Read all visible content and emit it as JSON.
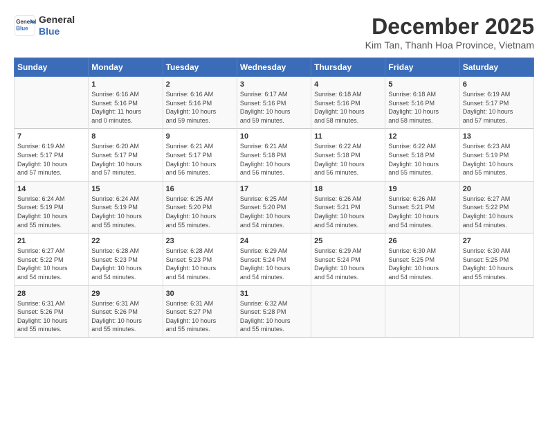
{
  "logo": {
    "line1": "General",
    "line2": "Blue"
  },
  "title": "December 2025",
  "subtitle": "Kim Tan, Thanh Hoa Province, Vietnam",
  "days_of_week": [
    "Sunday",
    "Monday",
    "Tuesday",
    "Wednesday",
    "Thursday",
    "Friday",
    "Saturday"
  ],
  "weeks": [
    [
      {
        "day": "",
        "info": ""
      },
      {
        "day": "1",
        "info": "Sunrise: 6:16 AM\nSunset: 5:16 PM\nDaylight: 11 hours\nand 0 minutes."
      },
      {
        "day": "2",
        "info": "Sunrise: 6:16 AM\nSunset: 5:16 PM\nDaylight: 10 hours\nand 59 minutes."
      },
      {
        "day": "3",
        "info": "Sunrise: 6:17 AM\nSunset: 5:16 PM\nDaylight: 10 hours\nand 59 minutes."
      },
      {
        "day": "4",
        "info": "Sunrise: 6:18 AM\nSunset: 5:16 PM\nDaylight: 10 hours\nand 58 minutes."
      },
      {
        "day": "5",
        "info": "Sunrise: 6:18 AM\nSunset: 5:16 PM\nDaylight: 10 hours\nand 58 minutes."
      },
      {
        "day": "6",
        "info": "Sunrise: 6:19 AM\nSunset: 5:17 PM\nDaylight: 10 hours\nand 57 minutes."
      }
    ],
    [
      {
        "day": "7",
        "info": "Sunrise: 6:19 AM\nSunset: 5:17 PM\nDaylight: 10 hours\nand 57 minutes."
      },
      {
        "day": "8",
        "info": "Sunrise: 6:20 AM\nSunset: 5:17 PM\nDaylight: 10 hours\nand 57 minutes."
      },
      {
        "day": "9",
        "info": "Sunrise: 6:21 AM\nSunset: 5:17 PM\nDaylight: 10 hours\nand 56 minutes."
      },
      {
        "day": "10",
        "info": "Sunrise: 6:21 AM\nSunset: 5:18 PM\nDaylight: 10 hours\nand 56 minutes."
      },
      {
        "day": "11",
        "info": "Sunrise: 6:22 AM\nSunset: 5:18 PM\nDaylight: 10 hours\nand 56 minutes."
      },
      {
        "day": "12",
        "info": "Sunrise: 6:22 AM\nSunset: 5:18 PM\nDaylight: 10 hours\nand 55 minutes."
      },
      {
        "day": "13",
        "info": "Sunrise: 6:23 AM\nSunset: 5:19 PM\nDaylight: 10 hours\nand 55 minutes."
      }
    ],
    [
      {
        "day": "14",
        "info": "Sunrise: 6:24 AM\nSunset: 5:19 PM\nDaylight: 10 hours\nand 55 minutes."
      },
      {
        "day": "15",
        "info": "Sunrise: 6:24 AM\nSunset: 5:19 PM\nDaylight: 10 hours\nand 55 minutes."
      },
      {
        "day": "16",
        "info": "Sunrise: 6:25 AM\nSunset: 5:20 PM\nDaylight: 10 hours\nand 55 minutes."
      },
      {
        "day": "17",
        "info": "Sunrise: 6:25 AM\nSunset: 5:20 PM\nDaylight: 10 hours\nand 54 minutes."
      },
      {
        "day": "18",
        "info": "Sunrise: 6:26 AM\nSunset: 5:21 PM\nDaylight: 10 hours\nand 54 minutes."
      },
      {
        "day": "19",
        "info": "Sunrise: 6:26 AM\nSunset: 5:21 PM\nDaylight: 10 hours\nand 54 minutes."
      },
      {
        "day": "20",
        "info": "Sunrise: 6:27 AM\nSunset: 5:22 PM\nDaylight: 10 hours\nand 54 minutes."
      }
    ],
    [
      {
        "day": "21",
        "info": "Sunrise: 6:27 AM\nSunset: 5:22 PM\nDaylight: 10 hours\nand 54 minutes."
      },
      {
        "day": "22",
        "info": "Sunrise: 6:28 AM\nSunset: 5:23 PM\nDaylight: 10 hours\nand 54 minutes."
      },
      {
        "day": "23",
        "info": "Sunrise: 6:28 AM\nSunset: 5:23 PM\nDaylight: 10 hours\nand 54 minutes."
      },
      {
        "day": "24",
        "info": "Sunrise: 6:29 AM\nSunset: 5:24 PM\nDaylight: 10 hours\nand 54 minutes."
      },
      {
        "day": "25",
        "info": "Sunrise: 6:29 AM\nSunset: 5:24 PM\nDaylight: 10 hours\nand 54 minutes."
      },
      {
        "day": "26",
        "info": "Sunrise: 6:30 AM\nSunset: 5:25 PM\nDaylight: 10 hours\nand 54 minutes."
      },
      {
        "day": "27",
        "info": "Sunrise: 6:30 AM\nSunset: 5:25 PM\nDaylight: 10 hours\nand 55 minutes."
      }
    ],
    [
      {
        "day": "28",
        "info": "Sunrise: 6:31 AM\nSunset: 5:26 PM\nDaylight: 10 hours\nand 55 minutes."
      },
      {
        "day": "29",
        "info": "Sunrise: 6:31 AM\nSunset: 5:26 PM\nDaylight: 10 hours\nand 55 minutes."
      },
      {
        "day": "30",
        "info": "Sunrise: 6:31 AM\nSunset: 5:27 PM\nDaylight: 10 hours\nand 55 minutes."
      },
      {
        "day": "31",
        "info": "Sunrise: 6:32 AM\nSunset: 5:28 PM\nDaylight: 10 hours\nand 55 minutes."
      },
      {
        "day": "",
        "info": ""
      },
      {
        "day": "",
        "info": ""
      },
      {
        "day": "",
        "info": ""
      }
    ]
  ]
}
